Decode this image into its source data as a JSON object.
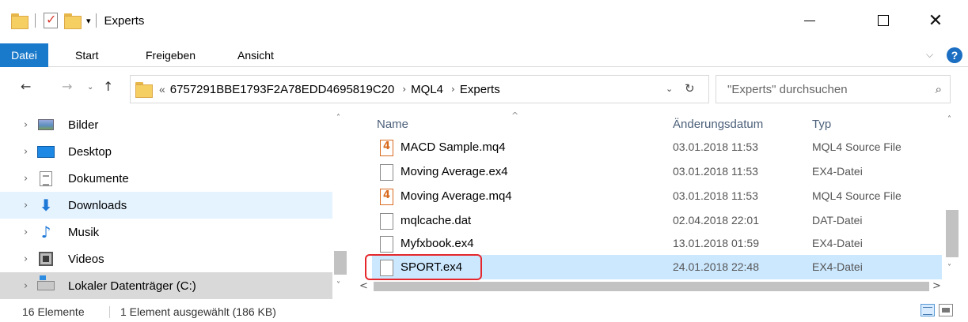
{
  "window": {
    "title": "Experts",
    "qat_arrow": "▾",
    "btn_min": "",
    "btn_max": "",
    "btn_close": "✕"
  },
  "ribbon": {
    "tabs": [
      "Datei",
      "Start",
      "Freigeben",
      "Ansicht"
    ],
    "collapse": "⌵",
    "help": "?",
    "file_tab_color": "#1979ca"
  },
  "address": {
    "overflow": "«",
    "crumbs": [
      "6757291BBE1793F2A78EDD4695819C20",
      "MQL4",
      "Experts"
    ],
    "separator": "›",
    "back": "←",
    "forward": "→",
    "recent": "⌄",
    "up": "↑",
    "dropdown": "⌄",
    "refresh": "↻"
  },
  "search": {
    "placeholder": "\"Experts\" durchsuchen",
    "icon": "⌕"
  },
  "navpane": {
    "chevron": "›",
    "items": [
      {
        "label": "Bilder",
        "icon": "pictures-icon"
      },
      {
        "label": "Desktop",
        "icon": "desktop-icon"
      },
      {
        "label": "Dokumente",
        "icon": "documents-icon"
      },
      {
        "label": "Downloads",
        "icon": "downloads-icon"
      },
      {
        "label": "Musik",
        "icon": "music-icon"
      },
      {
        "label": "Videos",
        "icon": "videos-icon"
      },
      {
        "label": "Lokaler Datenträger (C:)",
        "icon": "drive-icon"
      }
    ],
    "hovered_index": 3,
    "selected_index": 6
  },
  "filelist": {
    "columns": {
      "name": "Name",
      "date": "Änderungsdatum",
      "type": "Typ"
    },
    "sort_indicator": "^",
    "files": [
      {
        "name": "MACD Sample.mq4",
        "date": "03.01.2018 11:53",
        "type": "MQL4 Source File",
        "kind": "mq4"
      },
      {
        "name": "Moving Average.ex4",
        "date": "03.01.2018 11:53",
        "type": "EX4-Datei",
        "kind": "ex4"
      },
      {
        "name": "Moving Average.mq4",
        "date": "03.01.2018 11:53",
        "type": "MQL4 Source File",
        "kind": "mq4"
      },
      {
        "name": "mqlcache.dat",
        "date": "02.04.2018 22:01",
        "type": "DAT-Datei",
        "kind": "dat"
      },
      {
        "name": "Myfxbook.ex4",
        "date": "13.01.2018 01:59",
        "type": "EX4-Datei",
        "kind": "ex4"
      },
      {
        "name": "SPORT.ex4",
        "date": "24.01.2018 22:48",
        "type": "EX4-Datei",
        "kind": "ex4"
      }
    ],
    "selected_index": 5,
    "selection_color": "#cce8ff",
    "highlight_color": "#e5272c"
  },
  "scroll": {
    "up": "˄",
    "down": "˅",
    "left": "<",
    "right": ">"
  },
  "status": {
    "count": "16 Elemente",
    "selection": "1 Element ausgewählt (186 KB)"
  }
}
